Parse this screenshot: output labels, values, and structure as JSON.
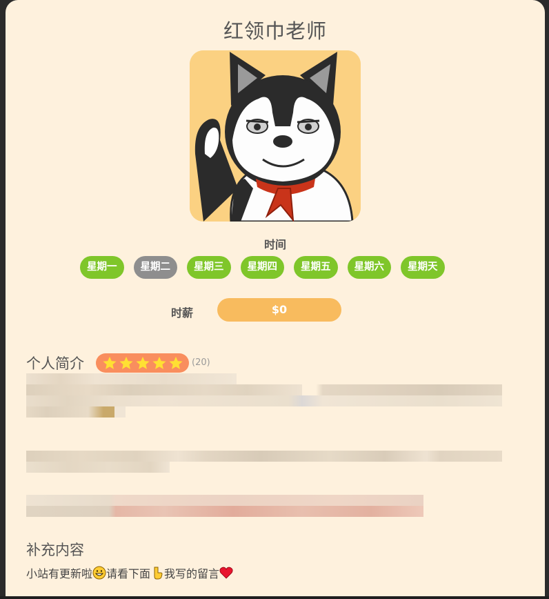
{
  "title": "红领巾老师",
  "avatar_alt": "husky-avatar",
  "schedule": {
    "label": "时间",
    "days": [
      {
        "label": "星期一",
        "available": true
      },
      {
        "label": "星期二",
        "available": false
      },
      {
        "label": "星期三",
        "available": true
      },
      {
        "label": "星期四",
        "available": true
      },
      {
        "label": "星期五",
        "available": true
      },
      {
        "label": "星期六",
        "available": true
      },
      {
        "label": "星期天",
        "available": true
      }
    ]
  },
  "wage": {
    "label": "时薪",
    "value": "$0"
  },
  "profile": {
    "title": "个人简介",
    "rating_stars": 5,
    "rating_count": "(20)"
  },
  "extra": {
    "title": "补充内容",
    "text_before": "小站有更新啦",
    "text_middle": " 请看下面",
    "text_after": "我写的留言"
  },
  "colors": {
    "card_bg": "#fef1dd",
    "available": "#7fc62a",
    "unavailable": "#8e8e8e",
    "wage_bar": "#f8bb5e",
    "rating_bg": "#f98e5e",
    "star": "#ffe033"
  }
}
